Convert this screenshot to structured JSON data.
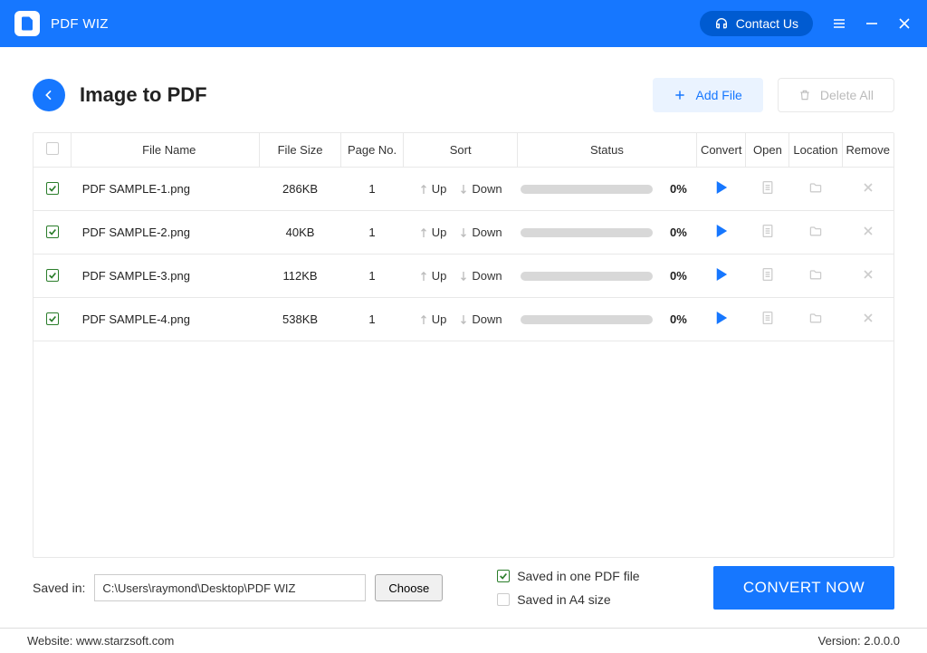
{
  "app": {
    "title": "PDF WIZ"
  },
  "titlebar": {
    "contact": "Contact Us"
  },
  "page": {
    "title": "Image to PDF",
    "add_file": "Add File",
    "delete_all": "Delete All"
  },
  "table": {
    "headers": {
      "filename": "File Name",
      "filesize": "File Size",
      "pageno": "Page No.",
      "sort": "Sort",
      "status": "Status",
      "convert": "Convert",
      "open": "Open",
      "location": "Location",
      "remove": "Remove"
    },
    "sort_up": "Up",
    "sort_down": "Down",
    "rows": [
      {
        "name": "PDF SAMPLE-1.png",
        "size": "286KB",
        "page": "1",
        "pct": "0%"
      },
      {
        "name": "PDF SAMPLE-2.png",
        "size": "40KB",
        "page": "1",
        "pct": "0%"
      },
      {
        "name": "PDF SAMPLE-3.png",
        "size": "112KB",
        "page": "1",
        "pct": "0%"
      },
      {
        "name": "PDF SAMPLE-4.png",
        "size": "538KB",
        "page": "1",
        "pct": "0%"
      }
    ]
  },
  "footer": {
    "saved_in_label": "Saved in:",
    "path": "C:\\Users\\raymond\\Desktop\\PDF WIZ",
    "choose": "Choose",
    "opt_one_pdf": "Saved in one PDF file",
    "opt_a4": "Saved in A4 size",
    "convert": "CONVERT NOW",
    "website": "Website: www.starzsoft.com",
    "version": "Version:  2.0.0.0"
  }
}
